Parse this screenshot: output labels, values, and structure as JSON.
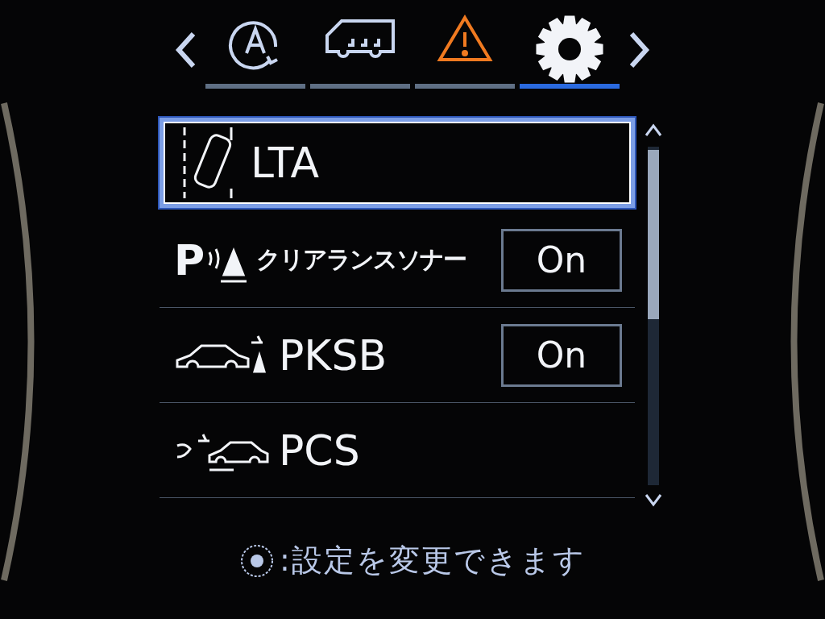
{
  "tabs": [
    {
      "kind": "auto",
      "selected": false
    },
    {
      "kind": "van",
      "selected": false
    },
    {
      "kind": "warning",
      "selected": false
    },
    {
      "kind": "gear",
      "selected": true
    }
  ],
  "items": [
    {
      "kind": "lane",
      "label": "LTA",
      "selected": true
    },
    {
      "kind": "sonar",
      "badge": "P",
      "label": "クリアランスソナー",
      "value": "On",
      "selected": false
    },
    {
      "kind": "pksb",
      "label": "PKSB",
      "value": "On",
      "selected": false
    },
    {
      "kind": "pcs",
      "label": "PCS",
      "selected": false
    }
  ],
  "hint": {
    "text": ":設定を変更できます"
  }
}
